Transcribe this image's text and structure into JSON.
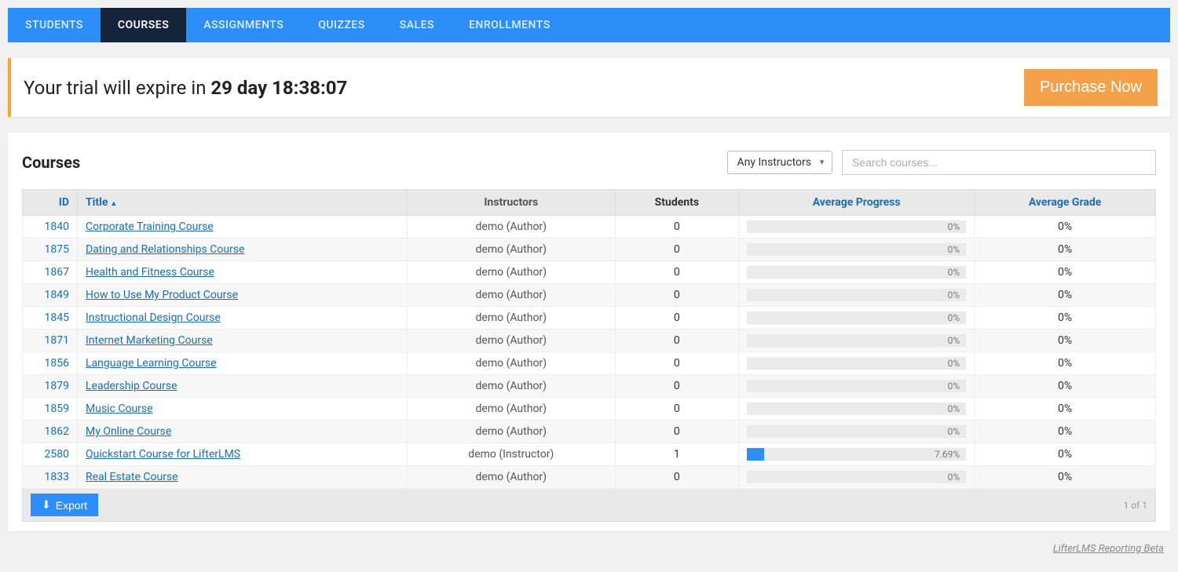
{
  "nav": {
    "tabs": [
      {
        "label": "STUDENTS",
        "active": false
      },
      {
        "label": "COURSES",
        "active": true
      },
      {
        "label": "ASSIGNMENTS",
        "active": false
      },
      {
        "label": "QUIZZES",
        "active": false
      },
      {
        "label": "SALES",
        "active": false
      },
      {
        "label": "ENROLLMENTS",
        "active": false
      }
    ]
  },
  "trial": {
    "prefix": "Your trial will expire in ",
    "countdown": "29 day 18:38:07",
    "button": "Purchase Now"
  },
  "panel": {
    "title": "Courses",
    "instructor_filter": "Any Instructors",
    "search_placeholder": "Search courses..."
  },
  "table": {
    "headers": {
      "id": "ID",
      "title": "Title",
      "instructors": "Instructors",
      "students": "Students",
      "avg_progress": "Average Progress",
      "avg_grade": "Average Grade"
    },
    "sort": {
      "column": "title",
      "dir": "asc"
    },
    "rows": [
      {
        "id": "1840",
        "title": "Corporate Training Course",
        "instructor": "demo (Author)",
        "students": "0",
        "progress_pct": 0,
        "progress_label": "0%",
        "grade": "0%"
      },
      {
        "id": "1875",
        "title": "Dating and Relationships Course",
        "instructor": "demo (Author)",
        "students": "0",
        "progress_pct": 0,
        "progress_label": "0%",
        "grade": "0%"
      },
      {
        "id": "1867",
        "title": "Health and Fitness Course",
        "instructor": "demo (Author)",
        "students": "0",
        "progress_pct": 0,
        "progress_label": "0%",
        "grade": "0%"
      },
      {
        "id": "1849",
        "title": "How to Use My Product Course",
        "instructor": "demo (Author)",
        "students": "0",
        "progress_pct": 0,
        "progress_label": "0%",
        "grade": "0%"
      },
      {
        "id": "1845",
        "title": "Instructional Design Course",
        "instructor": "demo (Author)",
        "students": "0",
        "progress_pct": 0,
        "progress_label": "0%",
        "grade": "0%"
      },
      {
        "id": "1871",
        "title": "Internet Marketing Course",
        "instructor": "demo (Author)",
        "students": "0",
        "progress_pct": 0,
        "progress_label": "0%",
        "grade": "0%"
      },
      {
        "id": "1856",
        "title": "Language Learning Course",
        "instructor": "demo (Author)",
        "students": "0",
        "progress_pct": 0,
        "progress_label": "0%",
        "grade": "0%"
      },
      {
        "id": "1879",
        "title": "Leadership Course",
        "instructor": "demo (Author)",
        "students": "0",
        "progress_pct": 0,
        "progress_label": "0%",
        "grade": "0%"
      },
      {
        "id": "1859",
        "title": "Music Course",
        "instructor": "demo (Author)",
        "students": "0",
        "progress_pct": 0,
        "progress_label": "0%",
        "grade": "0%"
      },
      {
        "id": "1862",
        "title": "My Online Course",
        "instructor": "demo (Author)",
        "students": "0",
        "progress_pct": 0,
        "progress_label": "0%",
        "grade": "0%"
      },
      {
        "id": "2580",
        "title": "Quickstart Course for LifterLMS",
        "instructor": "demo (Instructor)",
        "students": "1",
        "progress_pct": 7.69,
        "progress_label": "7.69%",
        "grade": "0%"
      },
      {
        "id": "1833",
        "title": "Real Estate Course",
        "instructor": "demo (Author)",
        "students": "0",
        "progress_pct": 0,
        "progress_label": "0%",
        "grade": "0%"
      }
    ]
  },
  "footer": {
    "export": "Export",
    "pager": "1 of 1",
    "reporting_link": "LifterLMS Reporting Beta"
  }
}
